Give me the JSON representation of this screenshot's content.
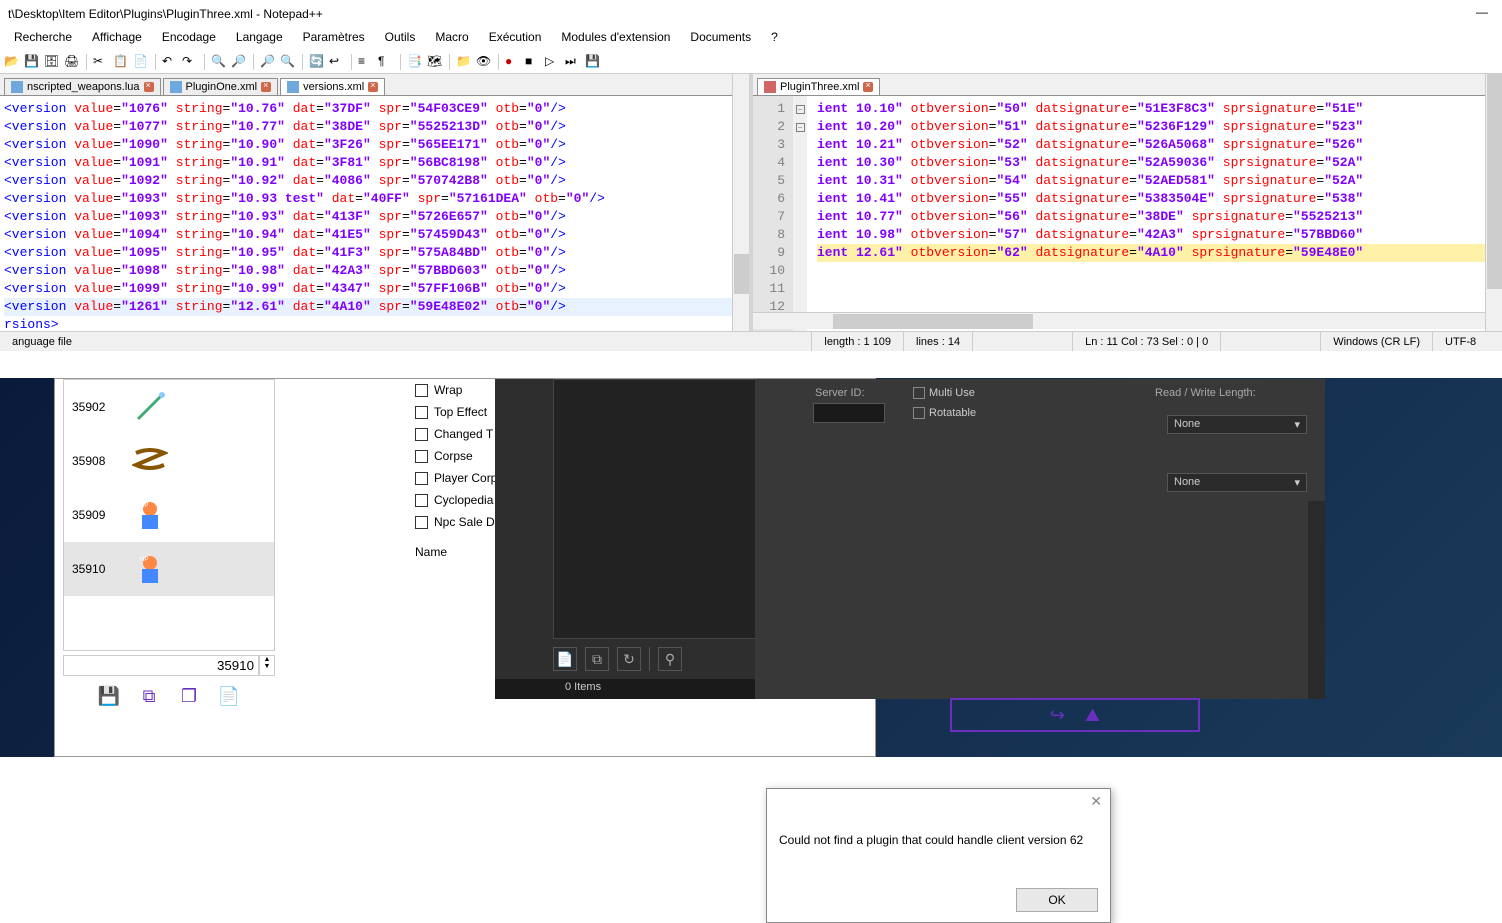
{
  "title": "t\\Desktop\\Item Editor\\Plugins\\PluginThree.xml - Notepad++",
  "menu": [
    "Recherche",
    "Affichage",
    "Encodage",
    "Langage",
    "Paramètres",
    "Outils",
    "Macro",
    "Exécution",
    "Modules d'extension",
    "Documents",
    "?"
  ],
  "tabs_left": [
    {
      "name": "nscripted_weapons.lua",
      "color": "#6fa8dc"
    },
    {
      "name": "PluginOne.xml",
      "color": "#6fa8dc"
    },
    {
      "name": "versions.xml",
      "color": "#6fa8dc"
    }
  ],
  "tabs_right": [
    {
      "name": "PluginThree.xml",
      "color": "#d06666"
    }
  ],
  "left_code": [
    {
      "tag": "version",
      "attrs": [
        [
          "value",
          "1076"
        ],
        [
          "string",
          "10.76"
        ],
        [
          "dat",
          "37DF"
        ],
        [
          "spr",
          "54F03CE9"
        ],
        [
          "otb",
          "0"
        ]
      ]
    },
    {
      "tag": "version",
      "attrs": [
        [
          "value",
          "1077"
        ],
        [
          "string",
          "10.77"
        ],
        [
          "dat",
          "38DE"
        ],
        [
          "spr",
          "5525213D"
        ],
        [
          "otb",
          "0"
        ]
      ]
    },
    {
      "tag": "version",
      "attrs": [
        [
          "value",
          "1090"
        ],
        [
          "string",
          "10.90"
        ],
        [
          "dat",
          "3F26"
        ],
        [
          "spr",
          "565EE171"
        ],
        [
          "otb",
          "0"
        ]
      ]
    },
    {
      "tag": "version",
      "attrs": [
        [
          "value",
          "1091"
        ],
        [
          "string",
          "10.91"
        ],
        [
          "dat",
          "3F81"
        ],
        [
          "spr",
          "56BC8198"
        ],
        [
          "otb",
          "0"
        ]
      ]
    },
    {
      "tag": "version",
      "attrs": [
        [
          "value",
          "1092"
        ],
        [
          "string",
          "10.92"
        ],
        [
          "dat",
          "4086"
        ],
        [
          "spr",
          "570742B8"
        ],
        [
          "otb",
          "0"
        ]
      ]
    },
    {
      "tag": "version",
      "attrs": [
        [
          "value",
          "1093"
        ],
        [
          "string",
          "10.93 test"
        ],
        [
          "dat",
          "40FF"
        ],
        [
          "spr",
          "57161DEA"
        ],
        [
          "otb",
          "0"
        ]
      ]
    },
    {
      "tag": "version",
      "attrs": [
        [
          "value",
          "1093"
        ],
        [
          "string",
          "10.93"
        ],
        [
          "dat",
          "413F"
        ],
        [
          "spr",
          "5726E657"
        ],
        [
          "otb",
          "0"
        ]
      ]
    },
    {
      "tag": "version",
      "attrs": [
        [
          "value",
          "1094"
        ],
        [
          "string",
          "10.94"
        ],
        [
          "dat",
          "41E5"
        ],
        [
          "spr",
          "57459D43"
        ],
        [
          "otb",
          "0"
        ]
      ]
    },
    {
      "tag": "version",
      "attrs": [
        [
          "value",
          "1095"
        ],
        [
          "string",
          "10.95"
        ],
        [
          "dat",
          "41F3"
        ],
        [
          "spr",
          "575A84BD"
        ],
        [
          "otb",
          "0"
        ]
      ]
    },
    {
      "tag": "version",
      "attrs": [
        [
          "value",
          "1098"
        ],
        [
          "string",
          "10.98"
        ],
        [
          "dat",
          "42A3"
        ],
        [
          "spr",
          "57BBD603"
        ],
        [
          "otb",
          "0"
        ]
      ]
    },
    {
      "tag": "version",
      "attrs": [
        [
          "value",
          "1099"
        ],
        [
          "string",
          "10.99"
        ],
        [
          "dat",
          "4347"
        ],
        [
          "spr",
          "57FF106B"
        ],
        [
          "otb",
          "0"
        ]
      ]
    },
    {
      "tag": "version",
      "attrs": [
        [
          "value",
          "1261"
        ],
        [
          "string",
          "12.61"
        ],
        [
          "dat",
          "4A10"
        ],
        [
          "spr",
          "59E48E02"
        ],
        [
          "otb",
          "0"
        ]
      ],
      "hl": true
    },
    {
      "close": "rsions>"
    }
  ],
  "right_lines": [
    1,
    2,
    3,
    4,
    5,
    6,
    7,
    8,
    9,
    10,
    11,
    12
  ],
  "right_code": [
    {
      "prefix": "ient 10.10\"",
      "attrs": [
        [
          "otbversion",
          "50"
        ],
        [
          "datsignature",
          "51E3F8C3"
        ],
        [
          "sprsignature",
          "51E"
        ]
      ]
    },
    {
      "prefix": "ient 10.20\"",
      "attrs": [
        [
          "otbversion",
          "51"
        ],
        [
          "datsignature",
          "5236F129"
        ],
        [
          "sprsignature",
          "523"
        ]
      ]
    },
    {
      "prefix": "ient 10.21\"",
      "attrs": [
        [
          "otbversion",
          "52"
        ],
        [
          "datsignature",
          "526A5068"
        ],
        [
          "sprsignature",
          "526"
        ]
      ]
    },
    {
      "prefix": "ient 10.30\"",
      "attrs": [
        [
          "otbversion",
          "53"
        ],
        [
          "datsignature",
          "52A59036"
        ],
        [
          "sprsignature",
          "52A"
        ]
      ]
    },
    {
      "prefix": "ient 10.31\"",
      "attrs": [
        [
          "otbversion",
          "54"
        ],
        [
          "datsignature",
          "52AED581"
        ],
        [
          "sprsignature",
          "52A"
        ]
      ]
    },
    {
      "prefix": "ient 10.41\"",
      "attrs": [
        [
          "otbversion",
          "55"
        ],
        [
          "datsignature",
          "5383504E"
        ],
        [
          "sprsignature",
          "538"
        ]
      ]
    },
    {
      "prefix": "ient 10.77\"",
      "attrs": [
        [
          "otbversion",
          "56"
        ],
        [
          "datsignature",
          "38DE"
        ],
        [
          "sprsignature",
          "5525213"
        ]
      ]
    },
    {
      "prefix": "ient 10.98\"",
      "attrs": [
        [
          "otbversion",
          "57"
        ],
        [
          "datsignature",
          "42A3"
        ],
        [
          "sprsignature",
          "57BBD60"
        ]
      ]
    },
    {
      "prefix": "ient 12.61\"",
      "attrs": [
        [
          "otbversion",
          "62"
        ],
        [
          "datsignature",
          "4A10"
        ],
        [
          "sprsignature",
          "59E48E0"
        ]
      ],
      "hl": true
    }
  ],
  "status": {
    "langfile": "anguage file",
    "length": "length : 1 109",
    "lines": "lines : 14",
    "pos": "Ln : 11   Col : 73   Sel : 0 | 0",
    "eol": "Windows (CR LF)",
    "enc": "UTF-8"
  },
  "items": [
    {
      "id": "35902",
      "sprite": "wand"
    },
    {
      "id": "35908",
      "sprite": "rope"
    },
    {
      "id": "35909",
      "sprite": "char"
    },
    {
      "id": "35910",
      "sprite": "char",
      "sel": true
    }
  ],
  "item_input": "35910",
  "checks": [
    "Wrap",
    "Top Effect",
    "Changed T",
    "Corpse",
    "Player Corp",
    "Cyclopedia",
    "Npc Sale D"
  ],
  "name_label": "Name",
  "dark_status": "0 Items",
  "server_id_label": "Server ID:",
  "multi_use": "Multi Use",
  "rotatable": "Rotatable",
  "rw_length": "Read / Write Length:",
  "none": "None",
  "dialog_msg": "Could not find a plugin that could handle client version 62",
  "dialog_ok": "OK"
}
